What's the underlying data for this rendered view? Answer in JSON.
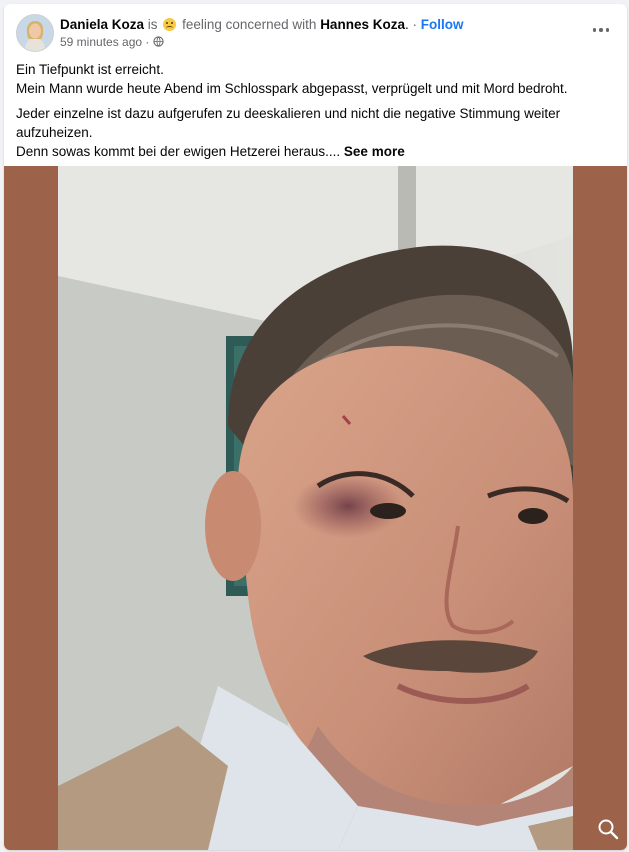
{
  "post": {
    "author": "Daniela Koza",
    "is_word": "is",
    "feeling": "feeling concerned with",
    "tagged": "Hannes Koza",
    "period": ".",
    "dot": "·",
    "follow": "Follow",
    "time": "59 minutes ago",
    "time_sep": "·",
    "privacy_icon": "globe-icon",
    "feeling_icon": "worried-face-icon",
    "menu_icon": "more-options-icon"
  },
  "text": {
    "line1": "Ein Tiefpunkt ist erreicht.",
    "line2": "Mein Mann wurde heute Abend im Schlosspark abgepasst, verprügelt und mit Mord bedroht.",
    "line3": "Jeder einzelne ist dazu aufgerufen zu deeskalieren und nicht die negative Stimmung weiter aufzuheizen.",
    "line4": "Denn sowas kommt bei der ewigen Hetzerei heraus....",
    "see_more": "See more"
  },
  "photo": {
    "zoom_icon": "search-icon"
  },
  "colors": {
    "accent": "#1877f2",
    "muted": "#65676b",
    "photo_border": "#9c624a"
  }
}
